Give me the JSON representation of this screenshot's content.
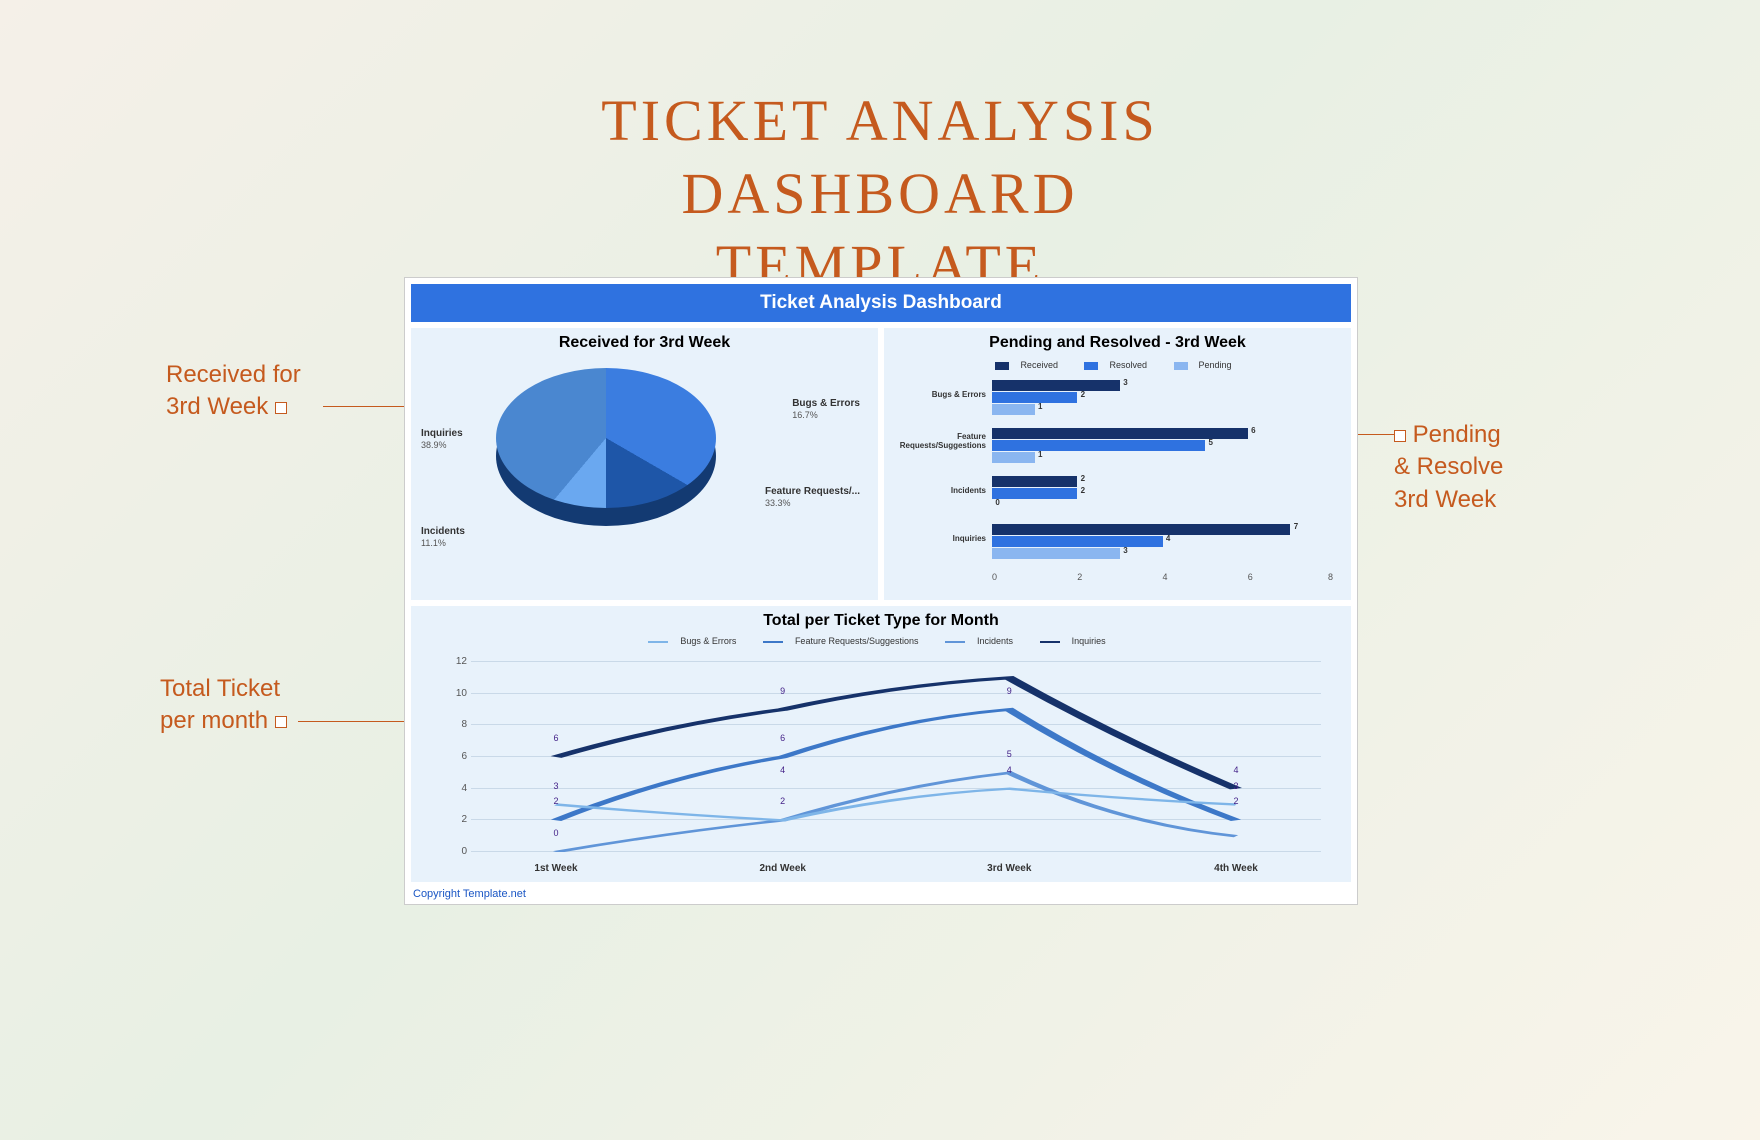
{
  "page_title_l1": "TICKET ANALYSIS DASHBOARD",
  "page_title_l2": "TEMPLATE",
  "header": "Ticket Analysis Dashboard",
  "copyright": "Copyright Template.net",
  "annotations": {
    "left_top": "Received for\n3rd Week",
    "left_bottom": "Total Ticket\nper month",
    "right": "Pending\n& Resolve\n3rd Week"
  },
  "pie": {
    "title": "Received for 3rd Week",
    "labels": {
      "inquiries": "Inquiries",
      "inquiries_pct": "38.9%",
      "bugs": "Bugs & Errors",
      "bugs_pct": "16.7%",
      "feature": "Feature Requests/...",
      "feature_pct": "33.3%",
      "incidents": "Incidents",
      "incidents_pct": "11.1%"
    }
  },
  "bar": {
    "title": "Pending and Resolved - 3rd Week",
    "legend": {
      "received": "Received",
      "resolved": "Resolved",
      "pending": "Pending"
    },
    "cats": {
      "c0": "Bugs & Errors",
      "c1": "Feature Requests/Suggestions",
      "c2": "Incidents",
      "c3": "Inquiries"
    },
    "x": {
      "t0": "0",
      "t2": "2",
      "t4": "4",
      "t6": "6",
      "t8": "8"
    }
  },
  "line": {
    "title": "Total per Ticket Type for Month",
    "legend": {
      "bugs": "Bugs & Errors",
      "feature": "Feature Requests/Suggestions",
      "incidents": "Incidents",
      "inquiries": "Inquiries"
    },
    "x": {
      "w1": "1st Week",
      "w2": "2nd Week",
      "w3": "3rd Week",
      "w4": "4th Week"
    },
    "y": {
      "y0": "0",
      "y2": "2",
      "y4": "4",
      "y6": "6",
      "y8": "8",
      "y10": "10",
      "y12": "12"
    }
  },
  "chart_data": [
    {
      "type": "pie",
      "title": "Received for 3rd Week",
      "slices": [
        {
          "name": "Inquiries",
          "pct": 38.9
        },
        {
          "name": "Feature Requests/Suggestions",
          "pct": 33.3
        },
        {
          "name": "Bugs & Errors",
          "pct": 16.7
        },
        {
          "name": "Incidents",
          "pct": 11.1
        }
      ]
    },
    {
      "type": "bar",
      "orientation": "horizontal",
      "title": "Pending and Resolved - 3rd Week",
      "categories": [
        "Bugs & Errors",
        "Feature Requests/Suggestions",
        "Incidents",
        "Inquiries"
      ],
      "series": [
        {
          "name": "Received",
          "values": [
            3,
            6,
            2,
            7
          ]
        },
        {
          "name": "Resolved",
          "values": [
            2,
            5,
            2,
            4
          ]
        },
        {
          "name": "Pending",
          "values": [
            1,
            1,
            0,
            3
          ]
        }
      ],
      "xlim": [
        0,
        8
      ]
    },
    {
      "type": "line",
      "title": "Total per Ticket Type for Month",
      "categories": [
        "1st Week",
        "2nd Week",
        "3rd Week",
        "4th Week"
      ],
      "series": [
        {
          "name": "Bugs & Errors",
          "values": [
            3,
            2,
            4,
            3
          ]
        },
        {
          "name": "Feature Requests/Suggestions",
          "values": [
            2,
            6,
            9,
            2
          ]
        },
        {
          "name": "Incidents",
          "values": [
            0,
            2,
            5,
            1
          ]
        },
        {
          "name": "Inquiries",
          "values": [
            6,
            9,
            11,
            4
          ]
        }
      ],
      "ylim": [
        0,
        12
      ]
    }
  ]
}
